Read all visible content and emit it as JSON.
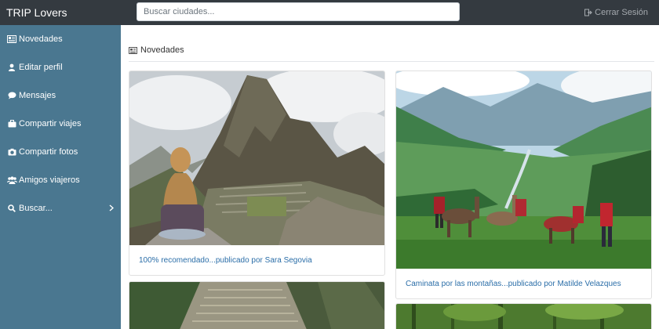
{
  "navbar": {
    "brand": "TRIP Lovers",
    "search_placeholder": "Buscar ciudades...",
    "logout_label": "Cerrar Sesión"
  },
  "sidebar": {
    "items": [
      {
        "label": "Novedades",
        "icon": "newspaper-icon"
      },
      {
        "label": "Editar perfil",
        "icon": "user-icon"
      },
      {
        "label": "Mensajes",
        "icon": "comment-icon"
      },
      {
        "label": "Compartir viajes",
        "icon": "briefcase-icon"
      },
      {
        "label": "Compartir fotos",
        "icon": "camera-icon"
      },
      {
        "label": "Amigos viajeros",
        "icon": "users-icon"
      },
      {
        "label": "Buscar...",
        "icon": "search-icon"
      }
    ]
  },
  "main": {
    "section_title": "Novedades",
    "posts": [
      {
        "caption": "100% recomendado...publicado por Sara Segovia"
      },
      {
        "caption": "Caminata por las montañas...publicado por Matilde Velazques"
      }
    ]
  },
  "colors": {
    "navbar": "#343a40",
    "sidebar": "#4a7790",
    "link": "#2b6ea8"
  }
}
